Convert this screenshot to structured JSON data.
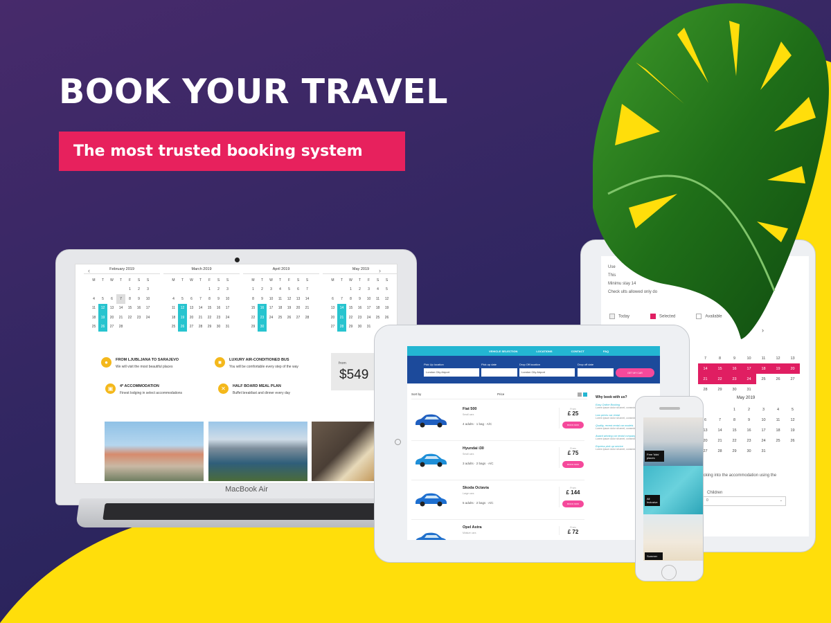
{
  "hero": {
    "headline": "BOOK YOUR TRAVEL",
    "tagline": "The most trusted booking system"
  },
  "colors": {
    "background": "#2e2660",
    "yellow": "#ffde0b",
    "pink": "#e7215d",
    "teal": "#27c4cf",
    "tablet_nav": "#23b6d2",
    "search_bar": "#1c4a9b"
  },
  "laptop": {
    "brand": "MacBook Air",
    "calendar": {
      "weekdays": [
        "M",
        "T",
        "W",
        "T",
        "F",
        "S",
        "S"
      ],
      "months": [
        {
          "title": "February 2019",
          "rows": [
            [
              "",
              "",
              "",
              "",
              "1",
              "2",
              "3"
            ],
            [
              "4",
              "5",
              "6",
              "7",
              "8",
              "9",
              "10"
            ],
            [
              "11",
              "12",
              "13",
              "14",
              "15",
              "16",
              "17"
            ],
            [
              "18",
              "19",
              "20",
              "21",
              "22",
              "23",
              "24"
            ],
            [
              "25",
              "26",
              "27",
              "28",
              "",
              "",
              ""
            ]
          ]
        },
        {
          "title": "March 2019",
          "rows": [
            [
              "",
              "",
              "",
              "",
              "1",
              "2",
              "3"
            ],
            [
              "4",
              "5",
              "6",
              "7",
              "8",
              "9",
              "10"
            ],
            [
              "11",
              "12",
              "13",
              "14",
              "15",
              "16",
              "17"
            ],
            [
              "18",
              "19",
              "20",
              "21",
              "22",
              "23",
              "24"
            ],
            [
              "25",
              "26",
              "27",
              "28",
              "29",
              "30",
              "31"
            ]
          ]
        },
        {
          "title": "April 2019",
          "rows": [
            [
              "1",
              "2",
              "3",
              "4",
              "5",
              "6",
              "7"
            ],
            [
              "8",
              "9",
              "10",
              "11",
              "12",
              "13",
              "14"
            ],
            [
              "15",
              "16",
              "17",
              "18",
              "19",
              "20",
              "21"
            ],
            [
              "22",
              "23",
              "24",
              "25",
              "26",
              "27",
              "28"
            ],
            [
              "29",
              "30",
              "",
              "",
              "",
              "",
              ""
            ]
          ]
        },
        {
          "title": "May 2019",
          "rows": [
            [
              "",
              "",
              "1",
              "2",
              "3",
              "4",
              "5"
            ],
            [
              "6",
              "7",
              "8",
              "9",
              "10",
              "11",
              "12"
            ],
            [
              "13",
              "14",
              "15",
              "16",
              "17",
              "18",
              "19"
            ],
            [
              "20",
              "21",
              "22",
              "23",
              "24",
              "25",
              "26"
            ],
            [
              "27",
              "28",
              "29",
              "30",
              "31",
              "",
              ""
            ]
          ]
        }
      ]
    },
    "features": [
      {
        "icon": "map-pin-icon",
        "glyph": "●",
        "title": "FROM LJUBLJANA TO SARAJEVO",
        "desc": "We will visit the most beautiful places"
      },
      {
        "icon": "bus-icon",
        "glyph": "■",
        "title": "LUXURY AIR-CONDITIONED BUS",
        "desc": "You will be comfortable every step of the way"
      },
      {
        "icon": "hotel-icon",
        "glyph": "▣",
        "title": "4* ACCOMMODATION",
        "desc": "Finest lodging in select accommodations"
      },
      {
        "icon": "meal-icon",
        "glyph": "✕",
        "title": "HALF BOARD MEAL PLAN",
        "desc": "Buffet breakfast and dinner every day"
      }
    ],
    "price": {
      "from": "from",
      "value": "$549"
    }
  },
  "tablet": {
    "nav": [
      "VEHICLE SELECTION",
      "LOCATIONS",
      "CONTACT",
      "FAQ"
    ],
    "search": {
      "labels": [
        "Pick Up location",
        "Pick up date",
        "Drop Off location",
        "Drop off date"
      ],
      "values": [
        "London City Airport",
        "",
        "London City Airport",
        ""
      ],
      "button": "GET MY CAR"
    },
    "sort": {
      "label": "Sort by",
      "price": "Price"
    },
    "cars": [
      {
        "name": "Fiat 500",
        "type": "Small cars",
        "features": "4 adults · 1 bag · A/C",
        "from": "From",
        "price": "£ 25",
        "book": "BOOK NOW",
        "color": "#1f5fc0"
      },
      {
        "name": "Hyundai i30",
        "type": "Small cars",
        "features": "3 adults · 2 bags · A/C",
        "from": "From",
        "price": "£ 75",
        "book": "BOOK NOW",
        "color": "#1e8fd8"
      },
      {
        "name": "Skoda Octavia",
        "type": "Large cars",
        "features": "5 adults · 2 bags · A/C",
        "from": "From",
        "price": "£ 144",
        "book": "BOOK NOW",
        "color": "#1d6fd0"
      },
      {
        "name": "Opel Astra",
        "type": "Midsize cars",
        "features": "",
        "from": "From",
        "price": "£ 72",
        "book": "",
        "color": "#2070cc"
      }
    ],
    "sidebar": {
      "title": "Why book with us?",
      "items": [
        {
          "t": "Easy Online Booking",
          "d": "Lorem ipsum dolor sit amet, consectetuer adipiscing elit."
        },
        {
          "t": "Low prices car rental",
          "d": "Lorem ipsum dolor sit amet, consectetuer adipiscing elit."
        },
        {
          "t": "Quality, recent rental car models",
          "d": "Lorem ipsum dolor sit amet, consectetuer adipiscing elit."
        },
        {
          "t": "Award winning car rental company",
          "d": "Lorem ipsum dolor sit amet, consectetuer adipiscing elit."
        },
        {
          "t": "Express pick up service",
          "d": "Lorem ipsum dolor sit amet, consectetuer adipiscing elit."
        }
      ]
    }
  },
  "back_tablet": {
    "lines": [
      "Use",
      "This",
      "Minimu            stay 14",
      "Check              ults allowed only do"
    ],
    "legend": [
      "Today",
      "Selected",
      "Available"
    ],
    "cal1": [
      [
        "",
        "",
        "",
        "",
        "",
        "",
        ""
      ],
      [
        "7",
        "8",
        "9",
        "10",
        "11",
        "12",
        "13"
      ],
      [
        "14",
        "15",
        "16",
        "17",
        "18",
        "19",
        "20"
      ],
      [
        "21",
        "22",
        "23",
        "24",
        "25",
        "26",
        "27"
      ],
      [
        "28",
        "29",
        "30",
        "31",
        "",
        "",
        ""
      ]
    ],
    "cal2_title": "May 2019",
    "cal2": [
      [
        "",
        "",
        "1",
        "2",
        "3",
        "4",
        "5"
      ],
      [
        "6",
        "7",
        "8",
        "9",
        "10",
        "11",
        "12"
      ],
      [
        "13",
        "14",
        "15",
        "16",
        "17",
        "18",
        "19"
      ],
      [
        "20",
        "21",
        "22",
        "23",
        "24",
        "25",
        "26"
      ],
      [
        "27",
        "28",
        "29",
        "30",
        "31",
        "",
        ""
      ]
    ],
    "note": "checking into the accommodation using the",
    "children_label": "Children",
    "select_value": "0"
  },
  "phone": {
    "tiles": [
      {
        "label": "Free 'kids' places"
      },
      {
        "label": "All Inclusive"
      },
      {
        "label": "Summer"
      }
    ]
  }
}
